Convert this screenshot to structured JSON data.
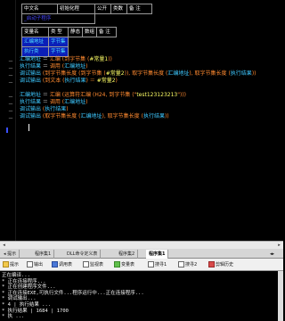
{
  "table1": {
    "row1": [
      "中文名",
      "初始化程",
      "公开",
      "类数",
      "备 注"
    ],
    "row2": [
      "_启动子程序",
      "",
      "",
      "",
      ""
    ]
  },
  "table2": {
    "header": [
      "变量名",
      "类 型",
      "静态",
      "数组",
      "备 注"
    ],
    "rows": [
      [
        "汇编地址",
        "字节集",
        "",
        "",
        ""
      ],
      [
        "执行类",
        "字节集",
        "",
        "",
        ""
      ]
    ]
  },
  "code": {
    "line1": {
      "a": "汇编地址",
      "b": " ＝ ",
      "c": "汇编",
      "d": " (到字节集 (",
      "e": "#常量1",
      "f": "))"
    },
    "line2": {
      "a": "执行结果",
      "b": " ＝ ",
      "c": "调用",
      "d": " (",
      "e": "汇编地址",
      "f": ")"
    },
    "line3": {
      "a": "调试输出",
      "b": " (到字节集长度 (到字节集 (",
      "c": "#常量2",
      "d": ")), 取字节集长度 (",
      "e": "汇编地址",
      "f": "), 取字节集长度 (",
      "g": "执行结果",
      "h": "))"
    },
    "line4": {
      "a": "调试输出",
      "b": " (到文本 (",
      "c": "执行结果",
      "d": ") ＝ ",
      "e": "#常量2",
      "f": ")"
    },
    "line5": {
      "a": "汇编地址",
      "b": " ＝ ",
      "c": "汇编",
      "d": " (运算符汇编 (H24, 到字节集 (\"",
      "e": "test123123213",
      "f": "\")))"
    },
    "line6": {
      "a": "执行结果",
      "b": " ＝ ",
      "c": "调用",
      "d": " (",
      "e": "汇编地址",
      "f": ")"
    },
    "line7": {
      "a": "调试输出",
      "b": " (",
      "c": "执行结果",
      "d": ")"
    },
    "line8": {
      "a": "调试输出",
      "b": " (取字节集长度 (",
      "c": "汇编地址",
      "d": "), 取字节集长度 (",
      "e": "执行结果",
      "f": "))"
    }
  },
  "tabs": [
    {
      "label": "◂ 提示",
      "active": false
    },
    {
      "label": "程序集1",
      "active": false
    },
    {
      "label": "DLL命令定义表",
      "active": false
    },
    {
      "label": "程序集2",
      "active": false
    },
    {
      "label": "程序集1",
      "active": true
    }
  ],
  "tab_nav": "◂▸",
  "toolbar": {
    "items": [
      "提示",
      "输出",
      "调用表",
      "监视表",
      "变量表",
      "搜寻1",
      "搜寻2",
      "剪辑历史"
    ]
  },
  "console": {
    "lines": [
      "正在编译...",
      "* 正在连接程序...",
      "* 正在创建程序文件...",
      "* 正在连接EXE,可执行文件...程序运行中...正在连接程序...",
      "* 调试输出...",
      "* 4 | 执行结果 ...",
      "* 执行结果 | 1684 | 1700",
      "* 执 ...",
      "* 退出"
    ]
  },
  "colors": {
    "editor_bg": "#000000",
    "variable": "#3ec8ff",
    "function": "#ff8a30",
    "constant": "#ffff66",
    "highlight_bg": "#0b1fb8"
  }
}
